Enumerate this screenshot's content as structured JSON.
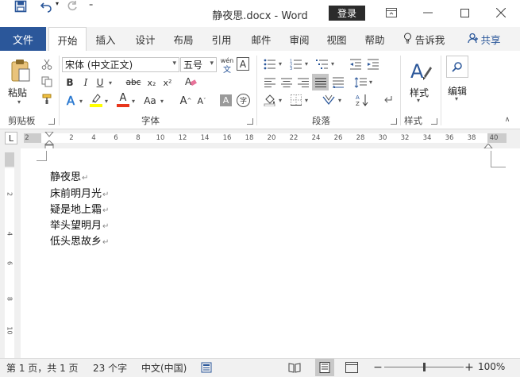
{
  "window": {
    "title": "静夜思.docx  -  Word",
    "login_label": "登录"
  },
  "tabs": {
    "file": "文件",
    "items": [
      "开始",
      "插入",
      "设计",
      "布局",
      "引用",
      "邮件",
      "审阅",
      "视图",
      "帮助"
    ],
    "tell_me": "告诉我",
    "share": "共享"
  },
  "ribbon": {
    "clipboard": {
      "paste_label": "粘贴",
      "group_label": "剪贴板"
    },
    "font": {
      "font_name": "宋体 (中文正文)",
      "font_size": "五号",
      "wen_top": "wén",
      "wen_bottom": "文",
      "char_border": "A",
      "bold": "B",
      "italic": "I",
      "underline": "U",
      "strike": "abc",
      "subscript": "x₂",
      "superscript": "x²",
      "text_effects": "A",
      "font_color": "A",
      "case": "Aa",
      "grow": "A",
      "shrink": "A",
      "shade": "A",
      "enclose": "字",
      "group_label": "字体"
    },
    "paragraph": {
      "group_label": "段落"
    },
    "styles": {
      "label": "样式",
      "group_label": "样式"
    },
    "editing": {
      "label": "编辑"
    }
  },
  "ruler": {
    "numbers": [
      "2",
      "2",
      "4",
      "6",
      "8",
      "10",
      "12",
      "14",
      "16",
      "18",
      "20",
      "22",
      "24",
      "26",
      "28",
      "30",
      "32",
      "34",
      "36",
      "38",
      "40"
    ],
    "tab_selector": "L"
  },
  "vruler": {
    "numbers": [
      "2",
      "4",
      "6",
      "8",
      "10"
    ]
  },
  "document": {
    "lines": [
      "静夜思",
      "床前明月光",
      "疑是地上霜",
      "举头望明月",
      "低头思故乡"
    ],
    "para_mark": "↵"
  },
  "status": {
    "page": "第 1 页，共 1 页",
    "words": "23 个字",
    "language": "中文(中国)",
    "zoom": "100%",
    "zoom_level": 1.0
  },
  "colors": {
    "accent": "#2b579a",
    "highlight": "#ffff00",
    "font_color": "#e8361c",
    "status_bg": "#f1f1f1"
  }
}
